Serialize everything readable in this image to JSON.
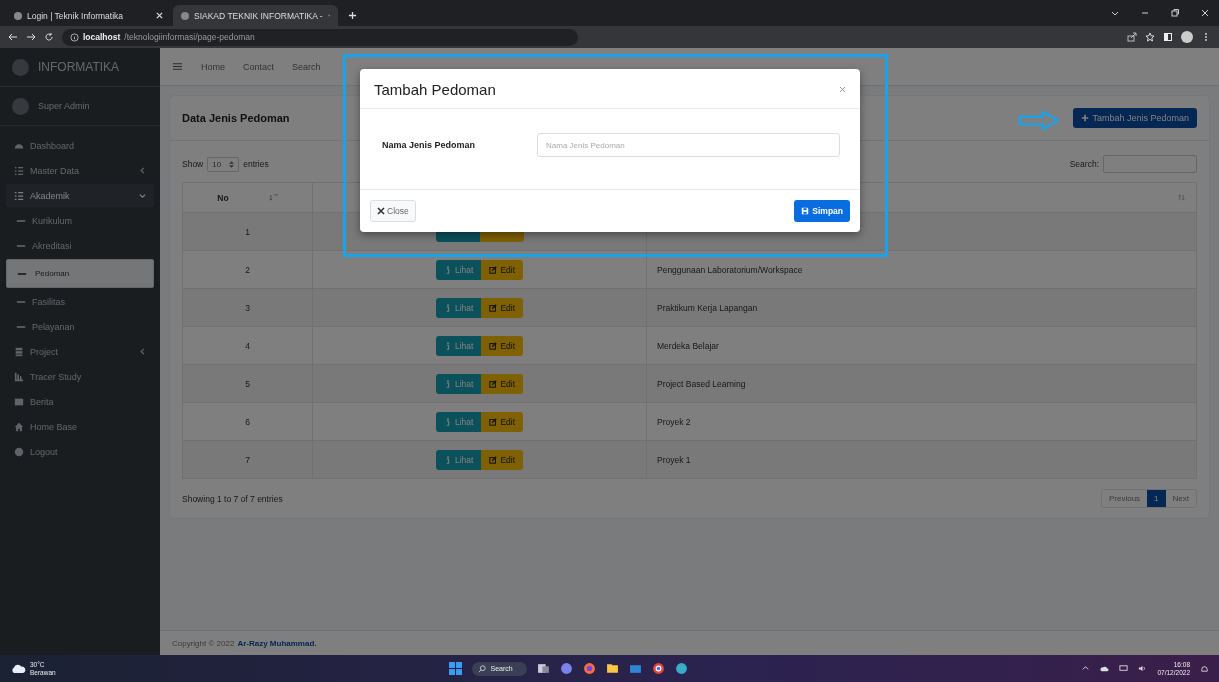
{
  "browser": {
    "tabs": [
      {
        "title": "Login | Teknik Informatika",
        "selected": false
      },
      {
        "title": "SIAKAD TEKNIK INFORMATIKA -",
        "selected": true
      }
    ],
    "address": {
      "host": "localhost",
      "path": "/teknologiinformasi/page-pedoman"
    }
  },
  "sidebar": {
    "brand": "INFORMATIKA",
    "user": "Super Admin",
    "items": [
      {
        "label": "Dashboard",
        "kind": "link",
        "selected": false
      },
      {
        "label": "Master Data",
        "kind": "group",
        "selected": false,
        "expanded": false
      },
      {
        "label": "Akademik",
        "kind": "group",
        "selected": false,
        "expanded": true
      },
      {
        "label": "Kurikulum",
        "kind": "sub",
        "selected": false
      },
      {
        "label": "Akreditasi",
        "kind": "sub",
        "selected": false
      },
      {
        "label": "Pedoman",
        "kind": "sub",
        "selected": true
      },
      {
        "label": "Fasilitas",
        "kind": "sub",
        "selected": false
      },
      {
        "label": "Pelayanan",
        "kind": "sub",
        "selected": false
      },
      {
        "label": "Project",
        "kind": "group",
        "selected": false,
        "expanded": false
      },
      {
        "label": "Tracer Study",
        "kind": "link",
        "selected": false
      },
      {
        "label": "Berita",
        "kind": "link",
        "selected": false
      },
      {
        "label": "Home Base",
        "kind": "link",
        "selected": false
      },
      {
        "label": "Logout",
        "kind": "link",
        "selected": false
      }
    ]
  },
  "navbar": {
    "links": [
      "Home",
      "Contact",
      "Search"
    ]
  },
  "card": {
    "title": "Data Jenis Pedoman",
    "add_button": "Tambah Jenis Pedoman"
  },
  "show_entries": {
    "before": "Show",
    "value": "10",
    "after": "entries"
  },
  "search_label": "Search:",
  "table": {
    "columns": [
      {
        "label": "No"
      }
    ],
    "rows": [
      {
        "no": "1"
      },
      {
        "no": "2",
        "name": "Penggunaan Laboratorium/Workspace",
        "view": "Lihat",
        "edit": "Edit"
      },
      {
        "no": "3",
        "name": "Praktikum Kerja Lapangan",
        "view": "Lihat",
        "edit": "Edit"
      },
      {
        "no": "4",
        "name": "Merdeka Belajar",
        "view": "Lihat",
        "edit": "Edit"
      },
      {
        "no": "5",
        "name": "Project Based Learning",
        "view": "Lihat",
        "edit": "Edit"
      },
      {
        "no": "6",
        "name": "Proyek 2",
        "view": "Lihat",
        "edit": "Edit"
      },
      {
        "no": "7",
        "name": "Proyek 1",
        "view": "Lihat",
        "edit": "Edit"
      }
    ]
  },
  "info": "Showing 1 to 7 of 7 entries",
  "pagination": {
    "previous": "Previous",
    "pages": [
      {
        "label": "1",
        "selected": true
      }
    ],
    "next": "Next"
  },
  "footer": {
    "text": "Copyright © 2022",
    "author": "Ar-Razy Muhammad."
  },
  "modal": {
    "title": "Tambah Pedoman",
    "field_label": "Nama Jenis Pedoman",
    "placeholder": "Nama Jenis Pedoman",
    "close": "Close",
    "save": "Simpan"
  },
  "taskbar": {
    "temperature": "30°C",
    "weather": "Berawan",
    "search": "Search",
    "time": "16:08",
    "date": "07/12/2022"
  }
}
